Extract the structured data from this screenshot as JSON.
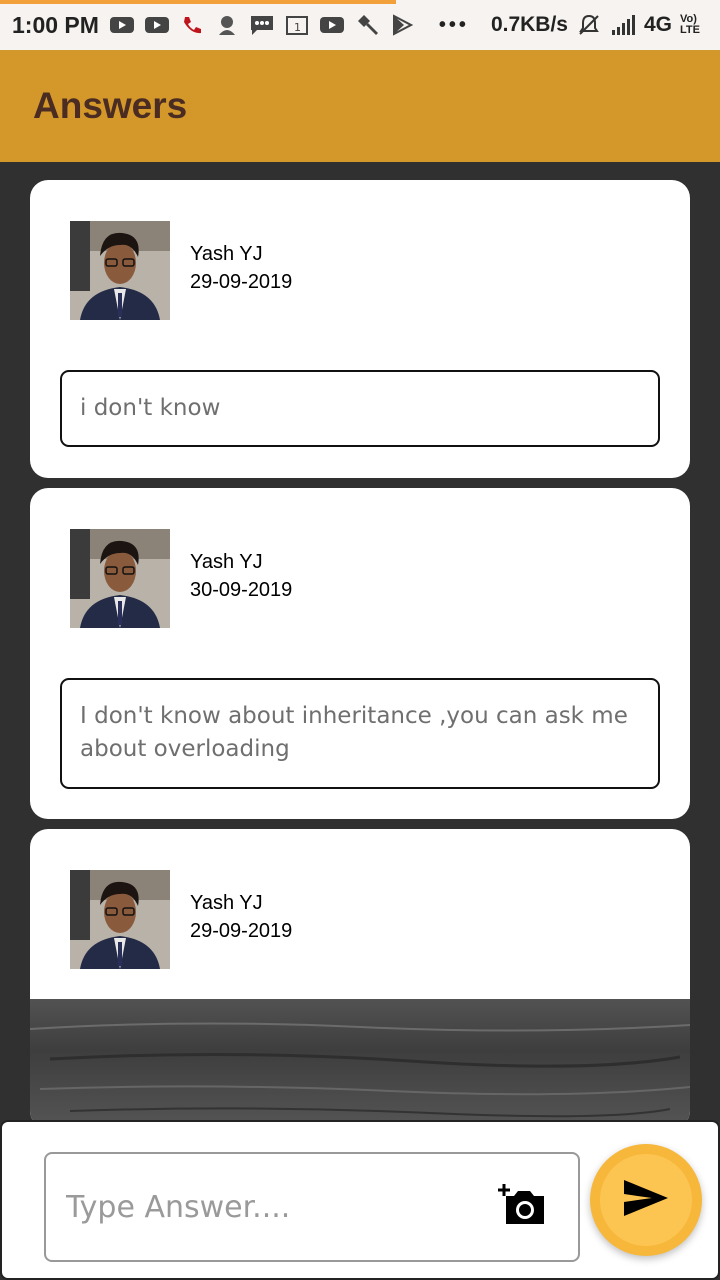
{
  "status_bar": {
    "time": "1:00 PM",
    "speed": "0.7KB/s",
    "network": "4G",
    "volte": "Vo) LTE",
    "icons": [
      "youtube-icon",
      "youtube-icon",
      "missed-call-icon",
      "person-icon",
      "message-icon",
      "calendar-icon",
      "youtube-icon",
      "hammer-icon",
      "play-store-icon"
    ]
  },
  "app_bar": {
    "title": "Answers"
  },
  "answers": [
    {
      "author": "Yash YJ",
      "date": "29-09-2019",
      "text": "i don't know"
    },
    {
      "author": "Yash YJ",
      "date": "30-09-2019",
      "text": "I don't know about inheritance ,you can ask me about overloading"
    },
    {
      "author": "Yash YJ",
      "date": "29-09-2019",
      "text": ""
    }
  ],
  "input": {
    "placeholder": "Type Answer....",
    "value": ""
  },
  "colors": {
    "accent": "#d4982a",
    "title": "#4a2c22",
    "send": "#f6b73b",
    "background": "#303030"
  }
}
